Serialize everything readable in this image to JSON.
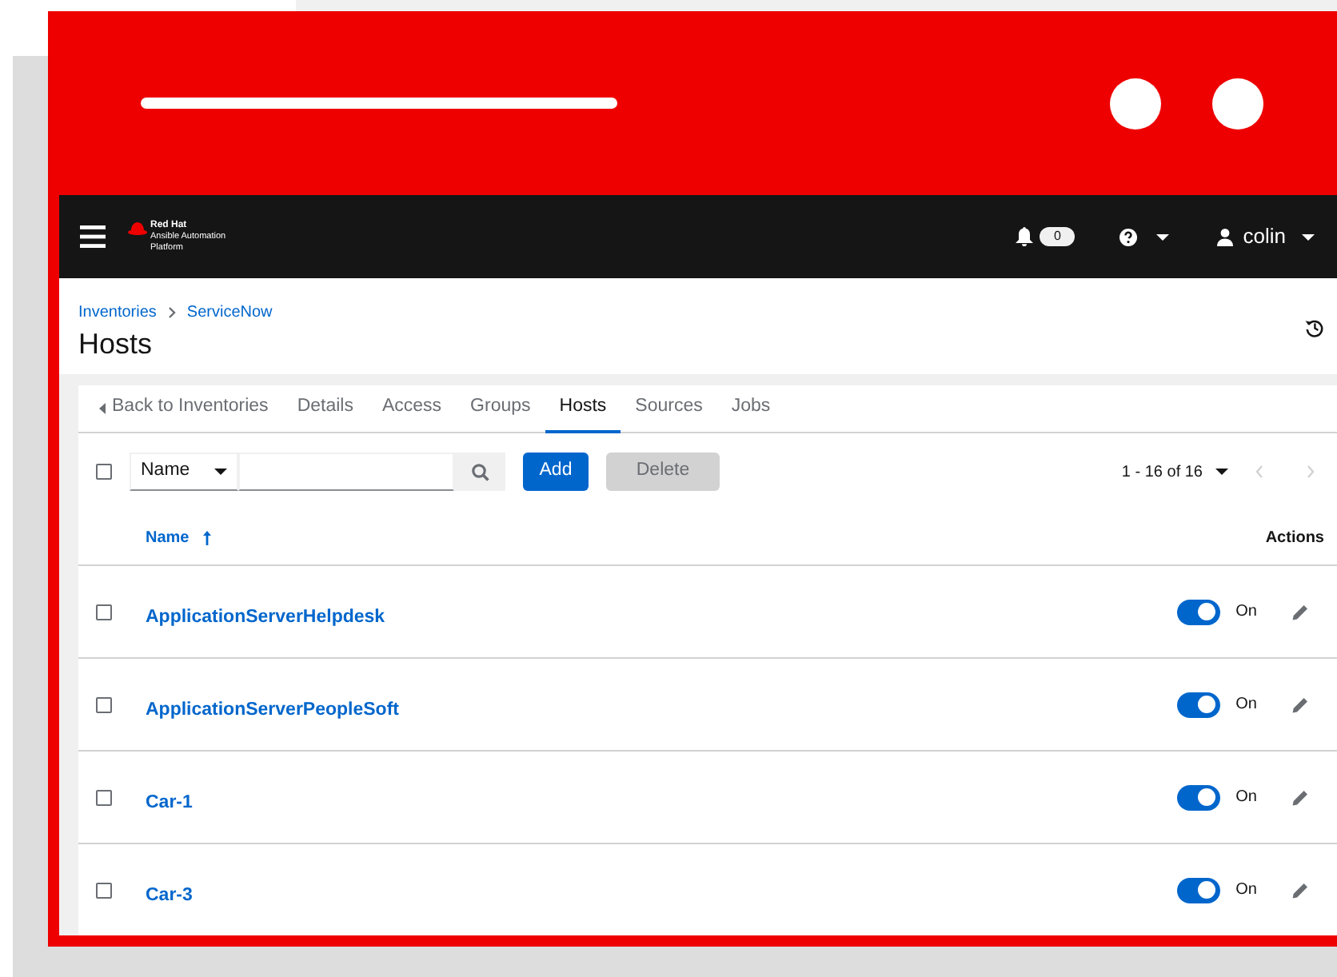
{
  "masthead": {
    "brand": [
      "Red Hat",
      "Ansible Automation",
      "Platform"
    ],
    "notifications": "0",
    "user": "colin"
  },
  "breadcrumb": [
    "Inventories",
    "ServiceNow"
  ],
  "title": "Hosts",
  "tabs": [
    {
      "label": "Back to Inventories",
      "kind": "back",
      "selected": false
    },
    {
      "label": "Details",
      "kind": "tab",
      "selected": false
    },
    {
      "label": "Access",
      "kind": "tab",
      "selected": false
    },
    {
      "label": "Groups",
      "kind": "tab",
      "selected": false
    },
    {
      "label": "Hosts",
      "kind": "tab",
      "selected": true
    },
    {
      "label": "Sources",
      "kind": "tab",
      "selected": false
    },
    {
      "label": "Jobs",
      "kind": "tab",
      "selected": false
    }
  ],
  "toolbar": {
    "select_all_checked": false,
    "filter_by": "Name",
    "add": "Add",
    "delete": "Delete",
    "delete_disabled": true,
    "pagination": "1 - 16 of 16"
  },
  "table": {
    "columns": [
      "Name",
      "Actions"
    ],
    "rows": [
      {
        "name": "ApplicationServerHelpdesk",
        "checked": false,
        "on": true,
        "toggle_label": "On"
      },
      {
        "name": "ApplicationServerPeopleSoft",
        "checked": false,
        "on": true,
        "toggle_label": "On"
      },
      {
        "name": "Car-1",
        "checked": false,
        "on": true,
        "toggle_label": "On"
      },
      {
        "name": "Car-3",
        "checked": false,
        "on": true,
        "toggle_label": "On"
      }
    ]
  }
}
